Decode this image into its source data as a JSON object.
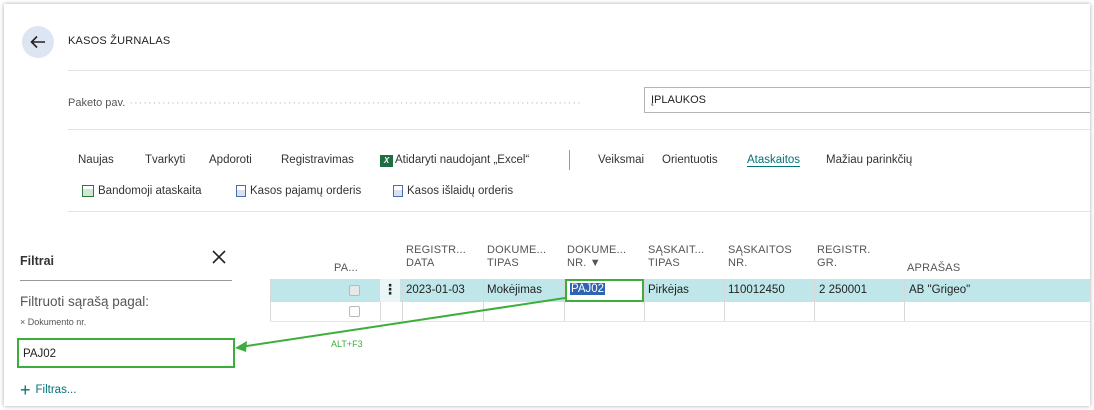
{
  "header": {
    "page_title": "KASOS ŽURNALAS"
  },
  "batch": {
    "label": "Paketo pav.",
    "value": "ĮPLAUKOS"
  },
  "actions": {
    "items": [
      "Naujas",
      "Tvarkyti",
      "Apdoroti",
      "Registravimas",
      "Atidaryti naudojant „Excel“",
      "Veiksmai",
      "Orientuotis",
      "Ataskaitos",
      "Mažiau parinkčių"
    ],
    "active": "Ataskaitos"
  },
  "sub_actions": [
    "Bandomoji ataskaita",
    "Kasos pajamų orderis",
    "Kasos išlaidų orderis"
  ],
  "filter_pane": {
    "title": "Filtrai",
    "filter_by": "Filtruoti sąrašą pagal:",
    "field_label": "× Dokumento nr.",
    "field_value": "PAJ02",
    "add_filter": "Filtras...",
    "shortcut_hint": "ALT+F3"
  },
  "grid": {
    "columns": [
      {
        "line1": "PA...",
        "line2": ""
      },
      {
        "line1": "REGISTR...",
        "line2": "DATA"
      },
      {
        "line1": "DOKUME...",
        "line2": "TIPAS"
      },
      {
        "line1": "DOKUME...",
        "line2": "NR. ▼"
      },
      {
        "line1": "SĄSKAIT...",
        "line2": "TIPAS"
      },
      {
        "line1": "SĄSKAITOS",
        "line2": "NR."
      },
      {
        "line1": "REGISTR.",
        "line2": "GR."
      },
      {
        "line1": "APRAŠAS",
        "line2": ""
      }
    ],
    "rows": [
      {
        "checked": true,
        "date": "2023-01-03",
        "doc_type": "Mokėjimas",
        "doc_no": "PAJ02",
        "account_type": "Pirkėjas",
        "account_no": "110012450",
        "posting_group": "2 250001",
        "description": "AB \"Grigeo\""
      }
    ]
  },
  "colors": {
    "accent": "#00727a",
    "highlight": "#3cae3c",
    "row_selected": "#bfe7ea"
  }
}
